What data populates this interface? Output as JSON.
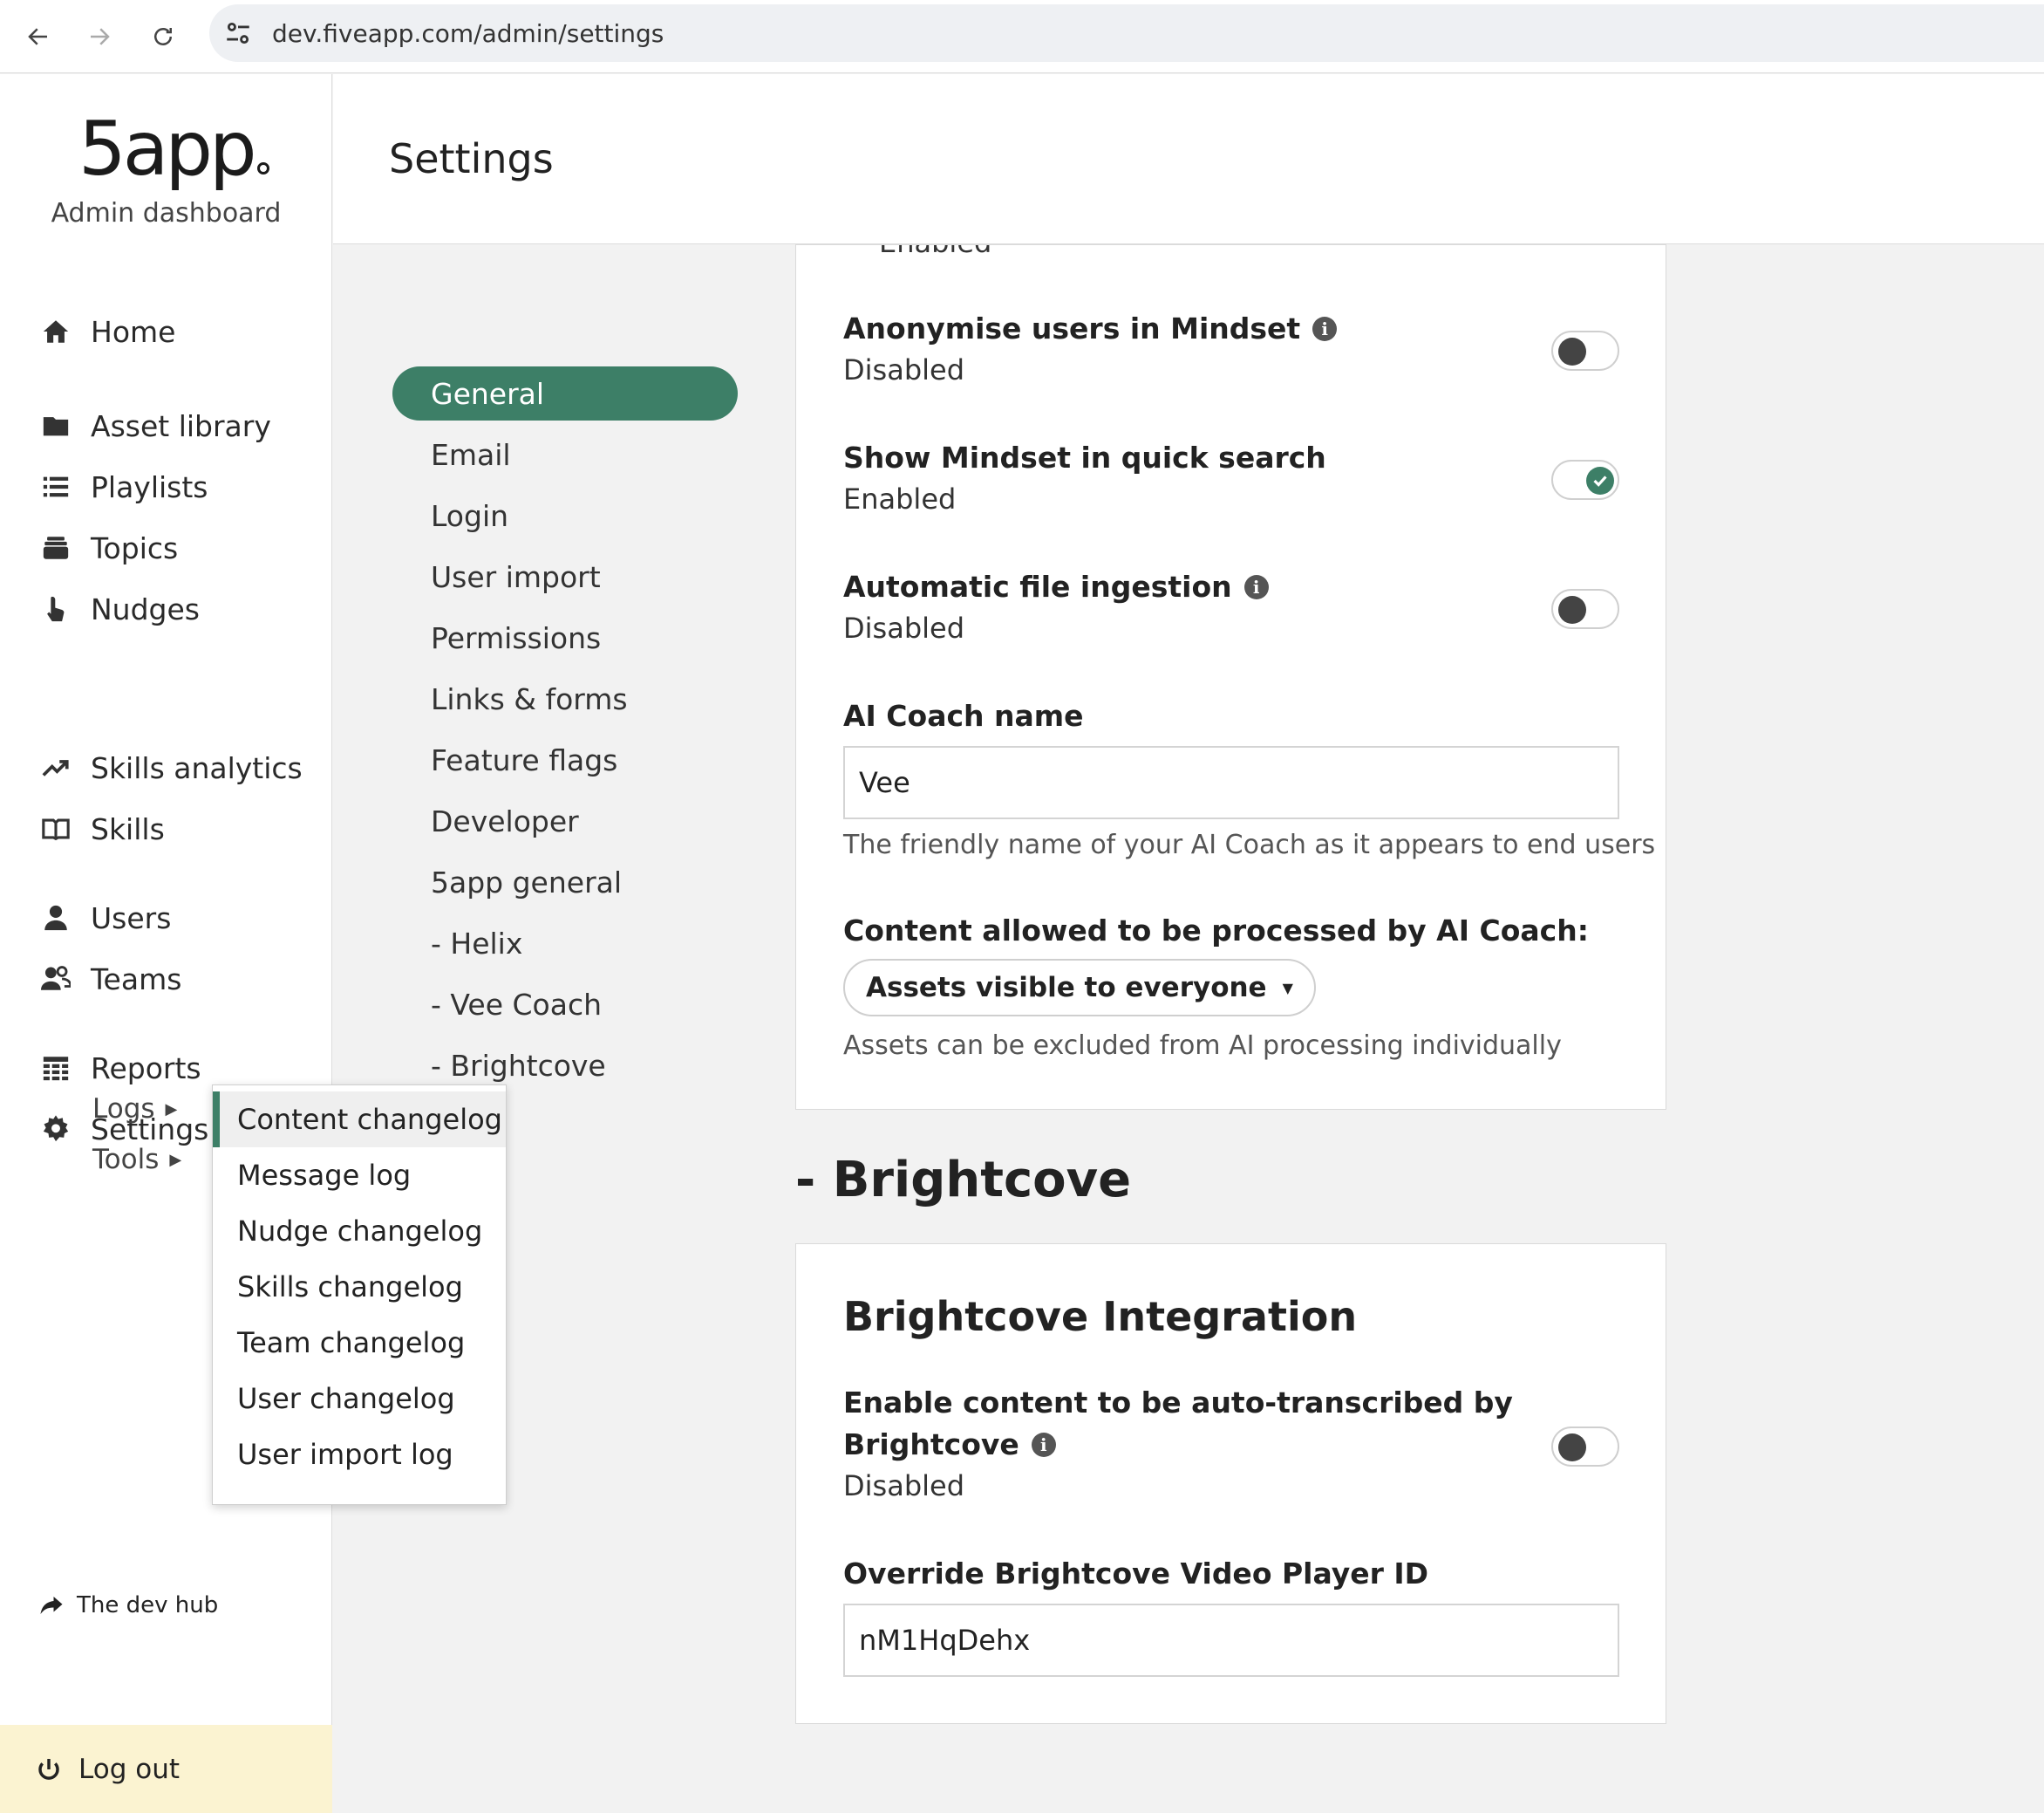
{
  "browser": {
    "url": "dev.fiveapp.com/admin/settings"
  },
  "sidebar": {
    "logo": "5app",
    "subtitle": "Admin dashboard",
    "items": [
      {
        "label": "Home",
        "icon": "home-icon"
      },
      {
        "label": "Asset library",
        "icon": "folder-icon"
      },
      {
        "label": "Playlists",
        "icon": "list-icon"
      },
      {
        "label": "Topics",
        "icon": "topics-icon"
      },
      {
        "label": "Nudges",
        "icon": "nudges-icon"
      },
      {
        "label": "Skills analytics",
        "icon": "trend-icon"
      },
      {
        "label": "Skills",
        "icon": "book-icon"
      },
      {
        "label": "Users",
        "icon": "user-icon"
      },
      {
        "label": "Teams",
        "icon": "team-icon"
      },
      {
        "label": "Reports",
        "icon": "table-icon"
      },
      {
        "label": "Settings",
        "icon": "gear-icon"
      }
    ],
    "sub_items": [
      {
        "label": "Logs"
      },
      {
        "label": "Tools"
      }
    ],
    "dev_hub": "The dev hub",
    "logout": "Log out"
  },
  "flyout": {
    "items": [
      {
        "label": "Content changelog",
        "active": true
      },
      {
        "label": "Message log"
      },
      {
        "label": "Nudge changelog"
      },
      {
        "label": "Skills changelog"
      },
      {
        "label": "Team changelog"
      },
      {
        "label": "User changelog"
      },
      {
        "label": "User import log"
      }
    ]
  },
  "header": {
    "title": "Settings"
  },
  "settings_nav": {
    "items": [
      {
        "label": "General",
        "active": true
      },
      {
        "label": "Email"
      },
      {
        "label": "Login"
      },
      {
        "label": "User import"
      },
      {
        "label": "Permissions"
      },
      {
        "label": "Links & forms"
      },
      {
        "label": "Feature flags"
      },
      {
        "label": "Developer"
      },
      {
        "label": "5app general"
      },
      {
        "label": "- Helix"
      },
      {
        "label": "- Vee Coach"
      },
      {
        "label": "- Brightcove"
      }
    ]
  },
  "coach_card": {
    "cut_status": "Enabled",
    "settings": [
      {
        "title": "Anonymise users in Mindset",
        "status": "Disabled",
        "enabled": false,
        "info": true
      },
      {
        "title": "Show Mindset in quick search",
        "status": "Enabled",
        "enabled": true,
        "info": false
      },
      {
        "title": "Automatic file ingestion",
        "status": "Disabled",
        "enabled": false,
        "info": true
      }
    ],
    "coach_name_label": "AI Coach name",
    "coach_name_value": "Vee",
    "coach_name_help": "The friendly name of your AI Coach as it appears to end users",
    "content_label": "Content allowed to be processed by AI Coach:",
    "content_select": "Assets visible to everyone",
    "content_help": "Assets can be excluded from AI processing individually"
  },
  "brightcove": {
    "section_heading": "- Brightcove",
    "card_title": "Brightcove Integration",
    "transcribe_title_line1": "Enable content to be auto-transcribed by",
    "transcribe_title_line2": "Brightcove",
    "transcribe_status": "Disabled",
    "transcribe_enabled": false,
    "player_label": "Override Brightcove Video Player ID",
    "player_value": "nM1HqDehx"
  },
  "colors": {
    "accent": "#3d7f67",
    "logout_bg": "#fbf3d1",
    "page_bg": "#f2f2f2"
  }
}
